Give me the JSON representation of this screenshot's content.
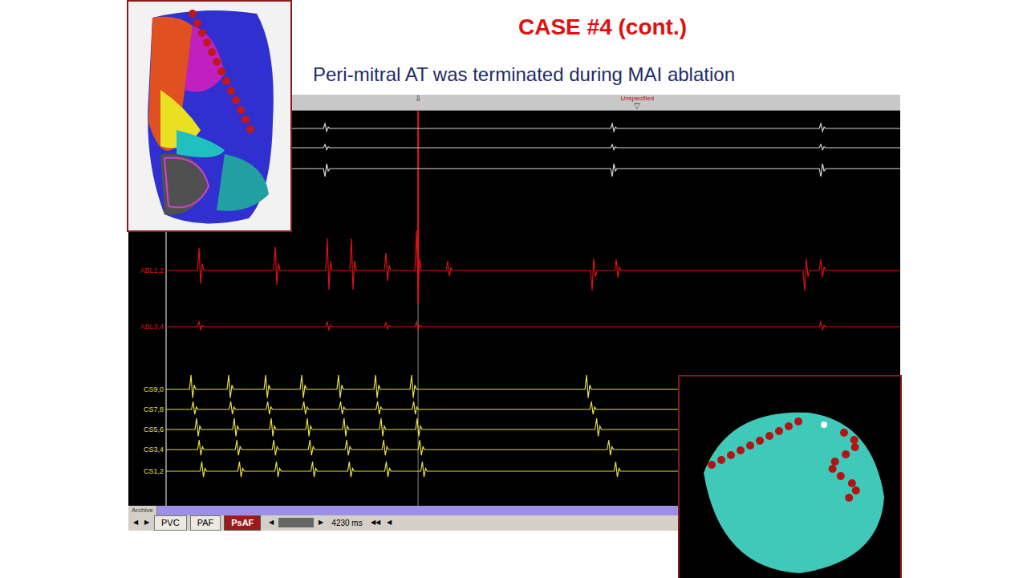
{
  "slide": {
    "title": "CASE #4 (cont.)",
    "subtitle": "Peri-mitral AT was terminated during MAI ablation"
  },
  "recording": {
    "markers": [
      {
        "icon": "⇩",
        "label": "",
        "ms": 1452
      },
      {
        "icon": "▽",
        "label": "Unspecified",
        "ms": 2715
      }
    ],
    "span_ms": 4230,
    "cursor_ms": 1452,
    "channels": [
      {
        "label": "",
        "group": "ecg",
        "color": "#d8d8d8",
        "beat_ms": [
          925,
          2580,
          3782
        ],
        "beat_amp": [
          6,
          6,
          6
        ]
      },
      {
        "label": "",
        "group": "ecg",
        "color": "#d8d8d8",
        "beat_ms": [
          925,
          2580,
          3782
        ],
        "beat_amp": [
          4,
          4,
          4
        ]
      },
      {
        "label": "",
        "group": "ecg",
        "color": "#d8d8d8",
        "beat_ms": [
          925,
          2580,
          3782
        ],
        "beat_amp": [
          -10,
          -10,
          -10
        ]
      },
      {
        "label": "ABL1,2",
        "group": "abl",
        "color": "#e01010",
        "beat_ms": [
          199,
          638,
          938,
          1077,
          1276,
          1452,
          1632,
          2464,
          2603,
          3689,
          3782
        ],
        "beat_amp": [
          28,
          30,
          40,
          40,
          22,
          50,
          12,
          -25,
          14,
          -25,
          14
        ]
      },
      {
        "label": "ABL3,4",
        "group": "abl",
        "color": "#e01010",
        "beat_ms": [
          199,
          938,
          1276,
          1452,
          3782
        ],
        "beat_amp": [
          6,
          6,
          5,
          6,
          6
        ]
      },
      {
        "label": "CS9,0",
        "group": "cs",
        "color": "#e8e040",
        "beat_ms": [
          153,
          370,
          583,
          791,
          1003,
          1216,
          1424,
          2432
        ],
        "beat_amp": [
          18,
          18,
          18,
          18,
          18,
          18,
          18,
          18
        ]
      },
      {
        "label": "CS7,8",
        "group": "cs",
        "color": "#e8e040",
        "beat_ms": [
          165,
          382,
          595,
          803,
          1015,
          1228,
          1436,
          2460
        ],
        "beat_amp": [
          10,
          10,
          10,
          10,
          10,
          10,
          10,
          10
        ]
      },
      {
        "label": "CS5,6",
        "group": "cs",
        "color": "#e8e040",
        "beat_ms": [
          185,
          402,
          615,
          823,
          1035,
          1248,
          1456,
          2490
        ],
        "beat_amp": [
          14,
          14,
          14,
          14,
          14,
          14,
          14,
          14
        ]
      },
      {
        "label": "CS3,4",
        "group": "cs",
        "color": "#e8e040",
        "beat_ms": [
          200,
          417,
          630,
          838,
          1050,
          1263,
          1471,
          2560
        ],
        "beat_amp": [
          12,
          12,
          12,
          12,
          12,
          12,
          12,
          12
        ]
      },
      {
        "label": "CS1,2",
        "group": "cs",
        "color": "#e8e040",
        "beat_ms": [
          215,
          432,
          645,
          853,
          1065,
          1278,
          1486,
          2600
        ],
        "beat_amp": [
          12,
          12,
          12,
          12,
          12,
          12,
          12,
          12
        ]
      }
    ]
  },
  "bottom_bar": {
    "archive_label": "Archive",
    "left_nav": [
      "◀",
      "▶"
    ],
    "tabs": [
      {
        "label": "PVC",
        "selected": false
      },
      {
        "label": "PAF",
        "selected": false
      },
      {
        "label": "PsAF",
        "selected": true
      }
    ],
    "scroll_nav": [
      "◀",
      "▶"
    ],
    "zoom": "4230 ms",
    "end_nav": [
      "◀◀",
      "◀"
    ]
  }
}
